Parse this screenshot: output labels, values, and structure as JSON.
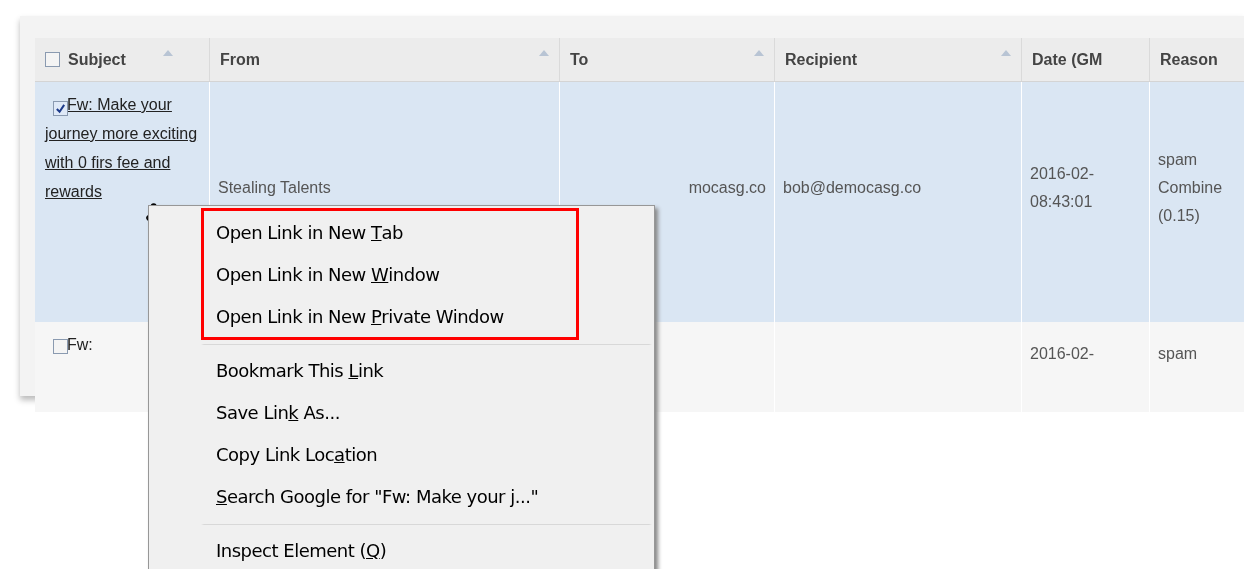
{
  "table": {
    "columns": [
      {
        "label": "Subject",
        "sort_arrow": true
      },
      {
        "label": "From",
        "sort_arrow": true
      },
      {
        "label": "To",
        "sort_arrow": true
      },
      {
        "label": "Recipient",
        "sort_arrow": true
      },
      {
        "label": "Date (GM",
        "sort_arrow": false
      },
      {
        "label": "Reason",
        "sort_arrow": false
      }
    ],
    "header_checked": false,
    "rows": [
      {
        "selected": true,
        "checked": true,
        "subject": "Fw: Make your journey more exciting with 0 firs fee and rewards",
        "from": "Stealing Talents",
        "to": "mocasg.co",
        "recipient": "bob@democasg.co",
        "date": "2016-02-\n08:43:01",
        "reason": "spam\nCombine\n(0.15)"
      },
      {
        "selected": false,
        "checked": false,
        "subject": "Fw:",
        "from": "",
        "to": "",
        "recipient": "",
        "date": "2016-02-",
        "reason": "spam"
      }
    ]
  },
  "context_menu": {
    "groups": [
      {
        "highlighted": true,
        "items": [
          {
            "pre": "Open Link in New ",
            "key": "T",
            "post": "ab"
          },
          {
            "pre": "Open Link in New ",
            "key": "W",
            "post": "indow"
          },
          {
            "pre": "Open Link in New ",
            "key": "P",
            "post": "rivate Window"
          }
        ]
      },
      {
        "highlighted": false,
        "items": [
          {
            "pre": "Bookmark This ",
            "key": "L",
            "post": "ink"
          },
          {
            "pre": "Save Lin",
            "key": "k",
            "post": " As..."
          },
          {
            "pre": "Copy Link Loc",
            "key": "a",
            "post": "tion"
          },
          {
            "key": "S",
            "post": "earch Google for \"Fw: Make your j...\""
          }
        ]
      },
      {
        "highlighted": false,
        "items": [
          {
            "pre": "Inspect Element (",
            "key": "Q",
            "post": ")"
          }
        ]
      }
    ]
  }
}
